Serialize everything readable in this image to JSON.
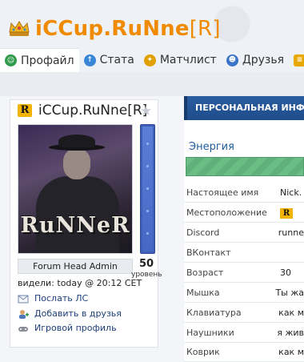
{
  "header": {
    "title_main": "iCCup.RuNne",
    "title_tag": "[R]",
    "crown_icon": "crown-icon",
    "title_color": "#f08a00"
  },
  "tabs": [
    {
      "label": "Профайл",
      "icon": "profile-icon",
      "color": "#2f9a4a",
      "active": true
    },
    {
      "label": "Стата",
      "icon": "stats-icon",
      "color": "#3a86d6"
    },
    {
      "label": "Матчлист",
      "icon": "matchlist-icon",
      "color": "#e0a000"
    },
    {
      "label": "Друзья",
      "icon": "friends-icon",
      "color": "#3a74c8"
    },
    {
      "label": "",
      "icon": "more-icon",
      "color": "#e8a800"
    }
  ],
  "profile": {
    "badge": "R",
    "nick": "iCCup.RuNne[R]",
    "avatar_text": "RuNNeR",
    "role": "Forum Head Admin",
    "level_value": "50",
    "level_label": "уровень",
    "seen": "видели: today @ 20:12 CET",
    "actions": [
      {
        "label": "Послать ЛС",
        "icon": "mail-icon"
      },
      {
        "label": "Добавить в друзья",
        "icon": "add-friend-icon"
      },
      {
        "label": "Игровой профиль",
        "icon": "game-profile-icon"
      }
    ]
  },
  "panel": {
    "header": "ПЕРСОНАЛЬНАЯ ИНФО",
    "energy_title": "Энергия",
    "rows": [
      {
        "key": "Настоящее имя",
        "value": "Nick."
      },
      {
        "key": "Местоположение",
        "value": "R"
      },
      {
        "key": "Discord",
        "value": "runne"
      },
      {
        "key": "ВКонтакт",
        "value": ""
      },
      {
        "key": "Возраст",
        "value": "30"
      },
      {
        "key": "Мышка",
        "value": "Ты жа"
      },
      {
        "key": "Клавиатура",
        "value": "как м"
      },
      {
        "key": "Наушники",
        "value": "я жив"
      },
      {
        "key": "Коврик",
        "value": "как м"
      }
    ]
  }
}
